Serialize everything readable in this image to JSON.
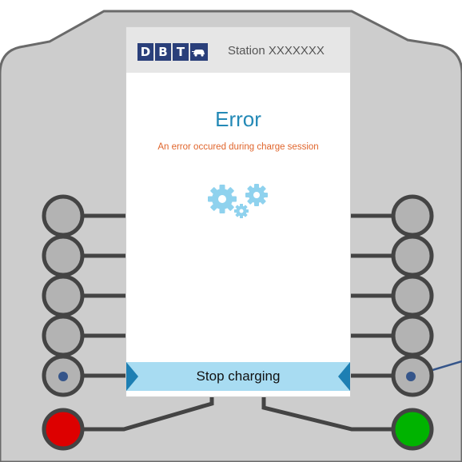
{
  "header": {
    "logo_letters": [
      "D",
      "B",
      "T"
    ],
    "logo_icon": "car-plug-icon",
    "station": "Station XXXXXXX"
  },
  "error": {
    "title": "Error",
    "message": "An error occured during charge session",
    "icon": "gears-icon"
  },
  "action": {
    "stop_label": "Stop charging"
  },
  "colors": {
    "panel": "#cdcdcd",
    "panel_outline": "#6a6a6a",
    "title_blue": "#2389b6",
    "error_orange": "#e0652c",
    "button_bg": "#a8dcf2",
    "button_arrow": "#1d7fb3",
    "logo_blue": "#2a3f7a",
    "red_button": "#dd0000",
    "green_button": "#00b300",
    "gear_blue": "#8fd2ee",
    "indicator_dot": "#35558a"
  }
}
